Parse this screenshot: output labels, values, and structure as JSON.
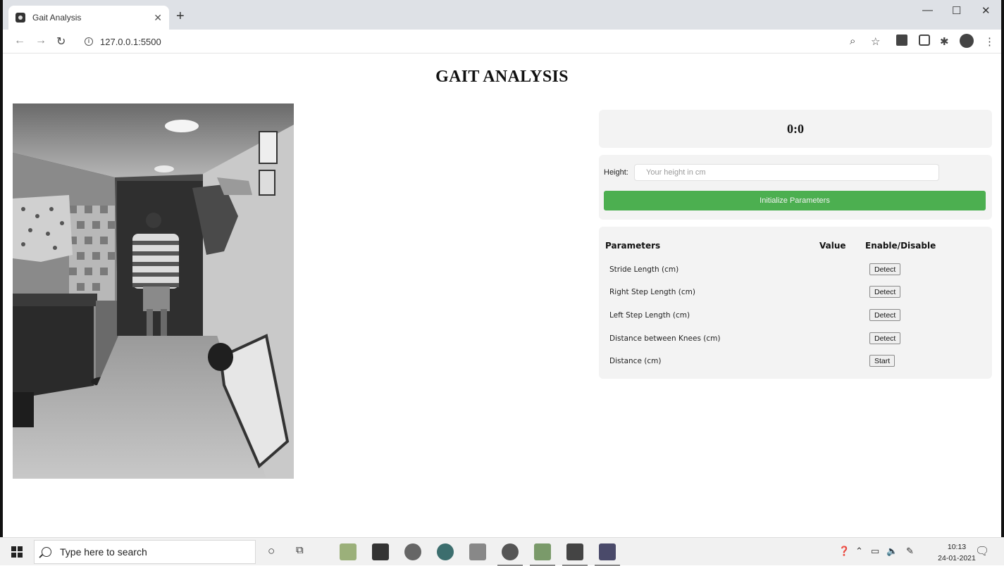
{
  "browser": {
    "tab_title": "Gait Analysis",
    "url": "127.0.0.1:5500"
  },
  "page": {
    "title": "GAIT ANALYSIS",
    "score": "0:0",
    "height_label": "Height:",
    "height_placeholder": "Your height in cm",
    "init_button": "Initialize Parameters"
  },
  "params": {
    "headers": {
      "name": "Parameters",
      "value": "Value",
      "toggle": "Enable/Disable"
    },
    "rows": [
      {
        "name": "Stride Length (cm)",
        "value": "",
        "action": "Detect"
      },
      {
        "name": "Right Step Length (cm)",
        "value": "",
        "action": "Detect"
      },
      {
        "name": "Left Step Length (cm)",
        "value": "",
        "action": "Detect"
      },
      {
        "name": "Distance between Knees (cm)",
        "value": "",
        "action": "Detect"
      },
      {
        "name": "Distance (cm)",
        "value": "",
        "action": "Start"
      }
    ]
  },
  "taskbar": {
    "search_placeholder": "Type here to search",
    "time": "10:13",
    "date": "24-01-2021"
  }
}
